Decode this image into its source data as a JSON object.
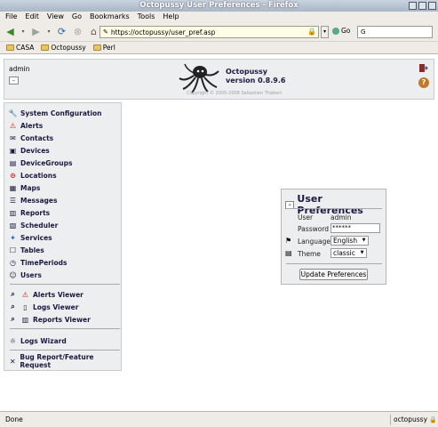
{
  "window": {
    "title": "Octopussy User Preferences - Firefox"
  },
  "menubar": {
    "items": [
      "File",
      "Edit",
      "View",
      "Go",
      "Bookmarks",
      "Tools",
      "Help"
    ]
  },
  "navbar": {
    "url": "https://octopussy/user_pref.asp",
    "go_label": "Go",
    "search_value": ""
  },
  "bookmarks": {
    "items": [
      "CASA",
      "Octopussy",
      "Perl"
    ]
  },
  "header": {
    "user": "admin",
    "app_name": "Octopussy",
    "version": "version 0.8.9.6",
    "copyright": "Copyright © 2005-2008 Sebastien Thebert"
  },
  "menu": {
    "items": [
      {
        "label": "System Configuration",
        "icon": "gear-icon"
      },
      {
        "label": "Alerts",
        "icon": "warning-icon"
      },
      {
        "label": "Contacts",
        "icon": "contacts-icon"
      },
      {
        "label": "Devices",
        "icon": "device-icon"
      },
      {
        "label": "DeviceGroups",
        "icon": "device-group-icon"
      },
      {
        "label": "Locations",
        "icon": "location-icon"
      },
      {
        "label": "Maps",
        "icon": "map-icon"
      },
      {
        "label": "Messages",
        "icon": "message-icon"
      },
      {
        "label": "Reports",
        "icon": "report-icon"
      },
      {
        "label": "Scheduler",
        "icon": "scheduler-icon"
      },
      {
        "label": "Services",
        "icon": "services-icon"
      },
      {
        "label": "Tables",
        "icon": "table-icon"
      },
      {
        "label": "TimePeriods",
        "icon": "clock-icon"
      },
      {
        "label": "Users",
        "icon": "user-icon"
      }
    ],
    "viewers": [
      {
        "label": "Alerts Viewer",
        "icon": "warning-icon"
      },
      {
        "label": "Logs Viewer",
        "icon": "log-icon"
      },
      {
        "label": "Reports Viewer",
        "icon": "report-icon"
      }
    ],
    "wizard": {
      "label": "Logs Wizard",
      "icon": "bulb-icon"
    },
    "bug": {
      "label": "Bug Report/Feature Request",
      "icon": "bug-icon"
    }
  },
  "prefs": {
    "title": "User Preferences",
    "user_label": "User",
    "user_value": "admin",
    "password_label": "Password",
    "password_value": "******",
    "language_label": "Language",
    "language_value": "English",
    "theme_label": "Theme",
    "theme_value": "classic",
    "update_label": "Update Preferences"
  },
  "status": {
    "text": "Done",
    "site": "octopussy"
  }
}
